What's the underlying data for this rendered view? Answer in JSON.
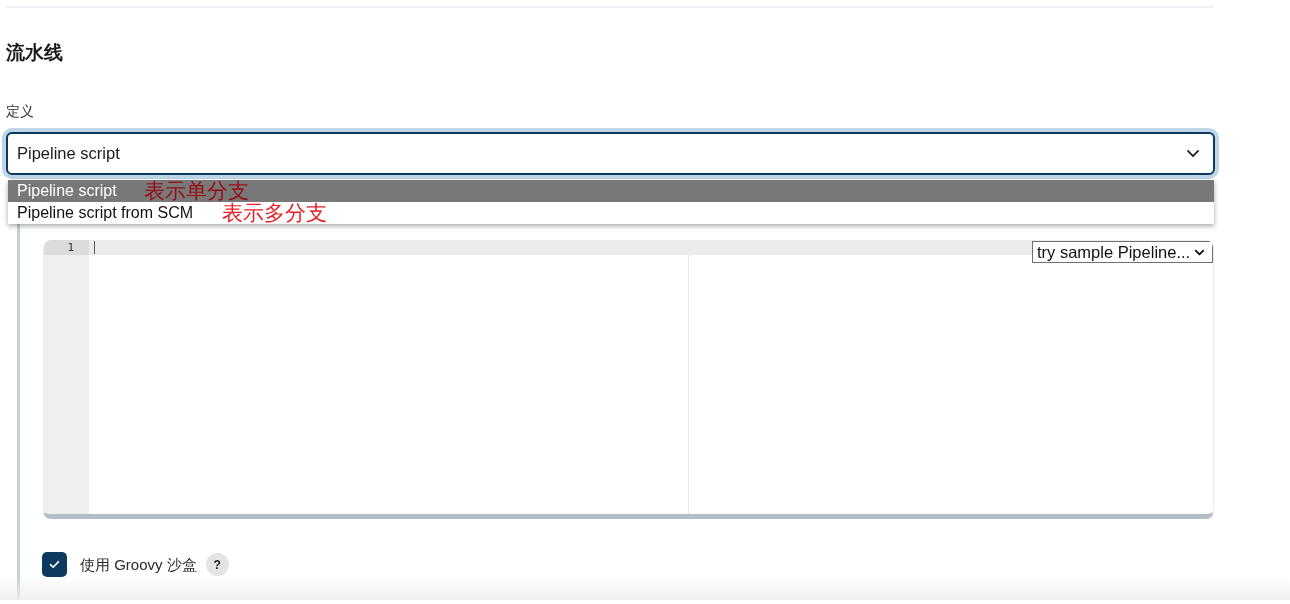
{
  "section": {
    "title": "流水线"
  },
  "definition": {
    "label": "定义",
    "select": {
      "value": "Pipeline script",
      "expanded": true
    },
    "options": [
      {
        "label": "Pipeline script",
        "selected": true,
        "annotation": "表示单分支"
      },
      {
        "label": "Pipeline script from SCM",
        "selected": false,
        "annotation": "表示多分支"
      }
    ]
  },
  "editor": {
    "lines": [
      {
        "number": "1",
        "active": true
      }
    ],
    "sample_select": {
      "value": "try sample Pipeline..."
    }
  },
  "sandbox": {
    "label": "使用 Groovy 沙盒",
    "checked": true,
    "help": "?"
  }
}
